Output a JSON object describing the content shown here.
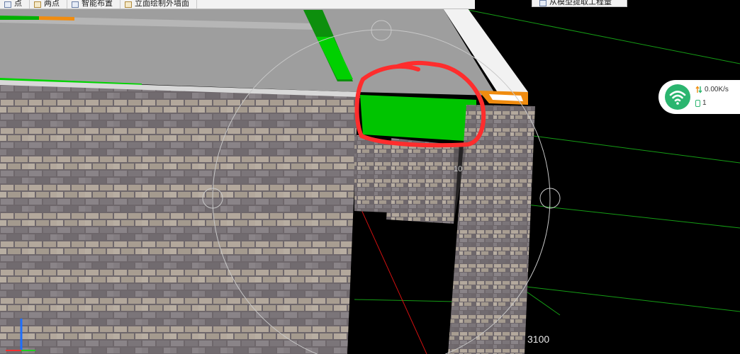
{
  "toolbar": {
    "items": [
      {
        "label": "点",
        "icon": "point-icon"
      },
      {
        "label": "两点",
        "icon": "two-point-icon"
      },
      {
        "label": "智能布置",
        "icon": "smart-layout-icon"
      },
      {
        "label": "立面绘制外墙面",
        "icon": "elevation-wall-icon"
      }
    ],
    "right_label": "从模型提取工程量"
  },
  "network": {
    "speed": "0.00K/s",
    "count": "1",
    "badge_color": "#2bb56f"
  },
  "viewport": {
    "dimension_label": "3100",
    "partial_label": "10"
  },
  "colors": {
    "background": "#000000",
    "slab": "#9e9e9e",
    "highlight_green": "#00c400",
    "annotation_red": "#ff2d2d",
    "orbit_ring": "#bdbdbd",
    "grid_green": "#159c15"
  }
}
